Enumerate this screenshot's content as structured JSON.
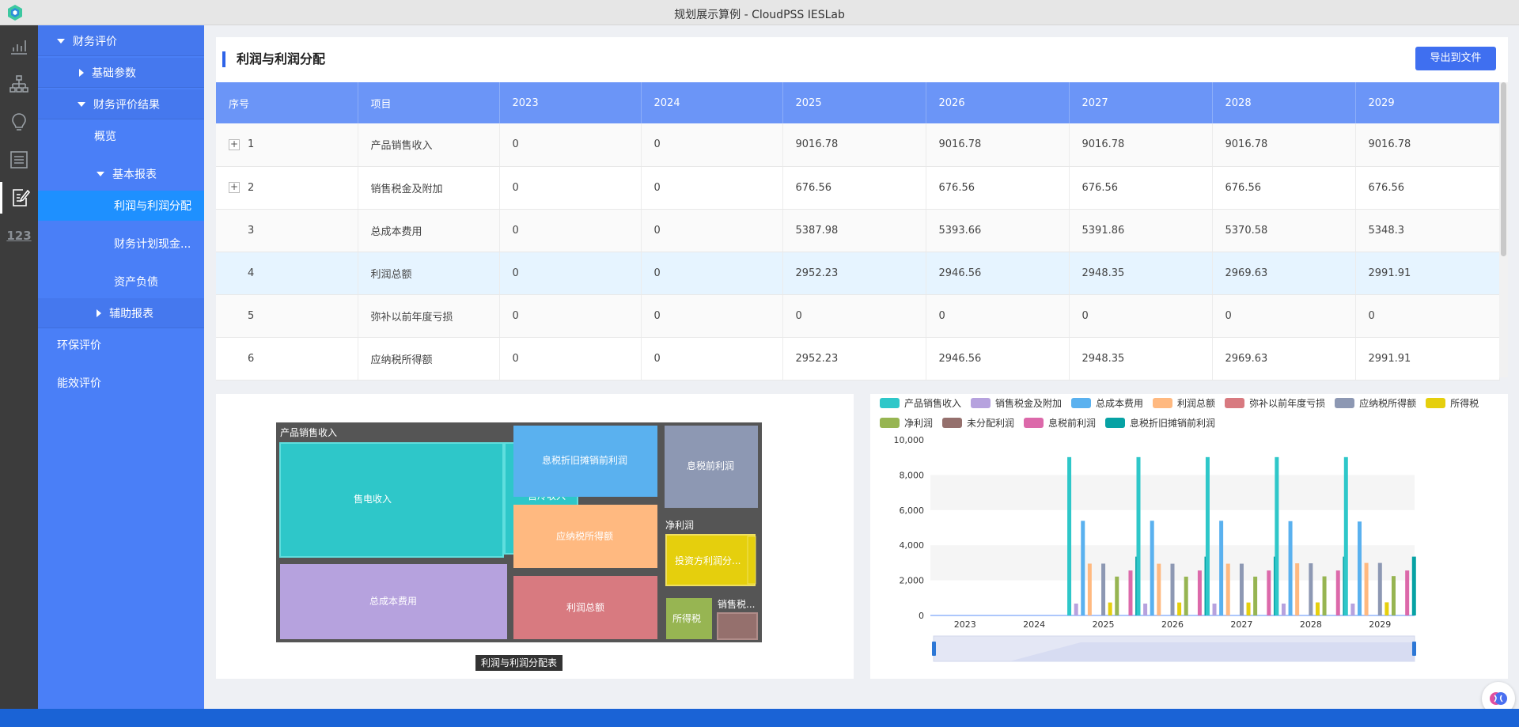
{
  "window": {
    "title": "规划展示算例 - CloudPSS IESLab"
  },
  "iconbar": {
    "items": [
      {
        "name": "chart-icon",
        "active": false
      },
      {
        "name": "topology-icon",
        "active": false
      },
      {
        "name": "bulb-icon",
        "active": false
      },
      {
        "name": "list-icon",
        "active": false
      },
      {
        "name": "edit-report-icon",
        "active": true
      },
      {
        "name": "number-icon",
        "active": false,
        "text": "123"
      }
    ]
  },
  "nav": {
    "items": [
      {
        "label": "财务评价",
        "caret": "down",
        "level": 1,
        "group": true
      },
      {
        "label": "基础参数",
        "caret": "right",
        "level": 2,
        "group": true
      },
      {
        "label": "财务评价结果",
        "caret": "down",
        "level": 2,
        "group": true
      },
      {
        "label": "概览",
        "caret": "",
        "level": 3
      },
      {
        "label": "基本报表",
        "caret": "down",
        "level": 3
      },
      {
        "label": "利润与利润分配",
        "caret": "",
        "level": 4,
        "selected": true
      },
      {
        "label": "财务计划现金...",
        "caret": "",
        "level": 4
      },
      {
        "label": "资产负债",
        "caret": "",
        "level": 4
      },
      {
        "label": "辅助报表",
        "caret": "right",
        "level": 3,
        "group": true
      },
      {
        "label": "环保评价",
        "caret": "",
        "level": 1
      },
      {
        "label": "能效评价",
        "caret": "",
        "level": 1
      }
    ]
  },
  "panel": {
    "title": "利润与利润分配",
    "export_label": "导出到文件"
  },
  "table": {
    "headers": [
      "序号",
      "项目",
      "2023",
      "2024",
      "2025",
      "2026",
      "2027",
      "2028",
      "2029"
    ],
    "rows": [
      {
        "cells": [
          "1",
          "产品销售收入",
          "0",
          "0",
          "9016.78",
          "9016.78",
          "9016.78",
          "9016.78",
          "9016.78"
        ],
        "expandable": true
      },
      {
        "cells": [
          "2",
          "销售税金及附加",
          "0",
          "0",
          "676.56",
          "676.56",
          "676.56",
          "676.56",
          "676.56"
        ],
        "expandable": true
      },
      {
        "cells": [
          "3",
          "总成本费用",
          "0",
          "0",
          "5387.98",
          "5393.66",
          "5391.86",
          "5370.58",
          "5348.3"
        ],
        "expandable": false
      },
      {
        "cells": [
          "4",
          "利润总额",
          "0",
          "0",
          "2952.23",
          "2946.56",
          "2948.35",
          "2969.63",
          "2991.91"
        ],
        "expandable": false,
        "highlight": true
      },
      {
        "cells": [
          "5",
          "弥补以前年度亏损",
          "0",
          "0",
          "0",
          "0",
          "0",
          "0",
          "0"
        ],
        "expandable": false
      },
      {
        "cells": [
          "6",
          "应纳税所得额",
          "0",
          "0",
          "2952.23",
          "2946.56",
          "2948.35",
          "2969.63",
          "2991.91"
        ],
        "expandable": false
      }
    ]
  },
  "treemap": {
    "tooltip": "利润与利润分配表",
    "labels": {
      "root": "产品销售收入",
      "a": "售电收入",
      "b": "售冷收入",
      "c": "总成本费用",
      "d": "息税折旧摊销前利润",
      "e": "应纳税所得额",
      "f": "利润总额",
      "g": "息税前利润",
      "h": "净利润",
      "i": "投资方利润分...",
      "j": "所得税",
      "k": "销售税..."
    },
    "colors": {
      "a": "#2ec7c9",
      "c": "#b6a2de",
      "d": "#5ab1ef",
      "e": "#ffb980",
      "f": "#d87a80",
      "g": "#8d98b3",
      "i": "#e5cf0d",
      "j": "#97b552",
      "k": "#95706d"
    }
  },
  "chart_data": {
    "type": "bar",
    "categories": [
      "2023",
      "2024",
      "2025",
      "2026",
      "2027",
      "2028",
      "2029"
    ],
    "ylim": [
      0,
      10000
    ],
    "yticks": [
      "0",
      "2,000",
      "4,000",
      "6,000",
      "8,000",
      "10,000"
    ],
    "series": [
      {
        "name": "产品销售收入",
        "color": "#2ec7c9",
        "values": [
          0,
          0,
          9016.78,
          9016.78,
          9016.78,
          9016.78,
          9016.78
        ]
      },
      {
        "name": "销售税金及附加",
        "color": "#b6a2de",
        "values": [
          0,
          0,
          676.56,
          676.56,
          676.56,
          676.56,
          676.56
        ]
      },
      {
        "name": "总成本费用",
        "color": "#5ab1ef",
        "values": [
          0,
          0,
          5387.98,
          5393.66,
          5391.86,
          5370.58,
          5348.3
        ]
      },
      {
        "name": "利润总额",
        "color": "#ffb980",
        "values": [
          0,
          0,
          2952.23,
          2946.56,
          2948.35,
          2969.63,
          2991.91
        ]
      },
      {
        "name": "弥补以前年度亏损",
        "color": "#d87a80",
        "values": [
          0,
          0,
          0,
          0,
          0,
          0,
          0
        ]
      },
      {
        "name": "应纳税所得额",
        "color": "#8d98b3",
        "values": [
          0,
          0,
          2952.23,
          2946.56,
          2948.35,
          2969.63,
          2991.91
        ]
      },
      {
        "name": "所得税",
        "color": "#e5cf0d",
        "values": [
          0,
          0,
          738,
          737,
          737,
          742,
          748
        ]
      },
      {
        "name": "净利润",
        "color": "#97b552",
        "values": [
          0,
          0,
          2214,
          2210,
          2211,
          2227,
          2244
        ]
      },
      {
        "name": "未分配利润",
        "color": "#95706d",
        "values": [
          0,
          0,
          0,
          0,
          0,
          0,
          0
        ]
      },
      {
        "name": "息税前利润",
        "color": "#dc69aa",
        "values": [
          0,
          0,
          2560,
          2560,
          2560,
          2560,
          2560
        ]
      },
      {
        "name": "息税折旧摊销前利润",
        "color": "#07a2a4",
        "values": [
          0,
          0,
          3350,
          3350,
          3350,
          3350,
          3350
        ]
      }
    ]
  }
}
